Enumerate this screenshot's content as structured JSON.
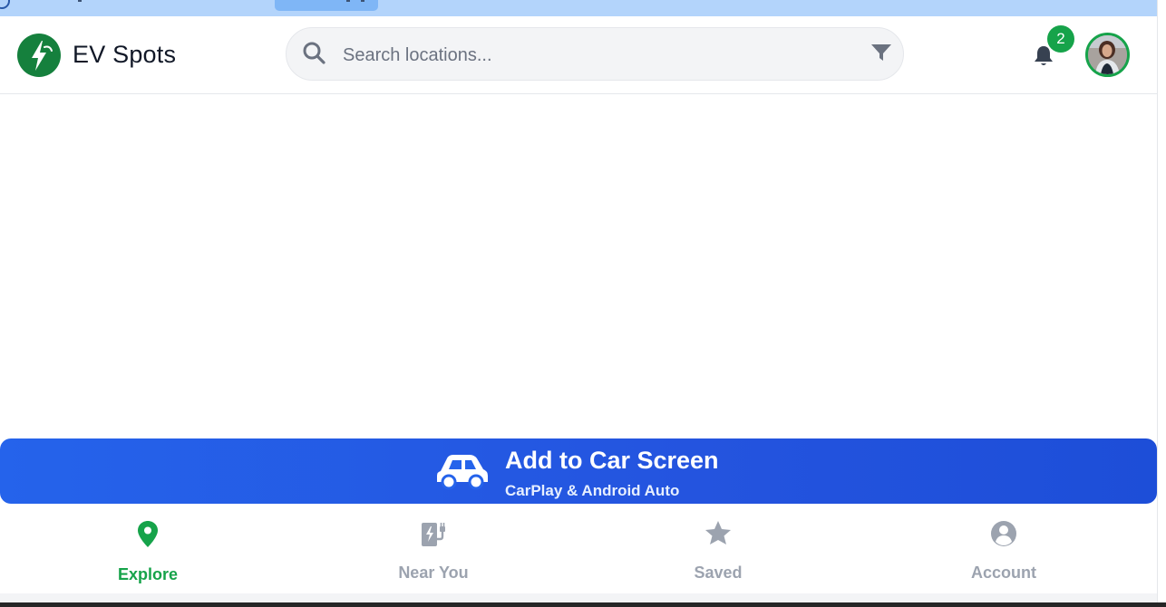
{
  "app": {
    "title": "EV Spots"
  },
  "search": {
    "placeholder": "Search locations..."
  },
  "notifications": {
    "count": "2"
  },
  "car_banner": {
    "title": "Add to Car Screen",
    "subtitle": "CarPlay & Android Auto"
  },
  "nav": {
    "items": [
      {
        "label": "Explore",
        "icon": "map-pin-icon",
        "active": true
      },
      {
        "label": "Near You",
        "icon": "charging-station-icon",
        "active": false
      },
      {
        "label": "Saved",
        "icon": "star-icon",
        "active": false
      },
      {
        "label": "Account",
        "icon": "user-circle-icon",
        "active": false
      }
    ]
  },
  "colors": {
    "brand_green": "#16a34a",
    "banner_blue": "#2563eb",
    "inactive_gray": "#9ca3af"
  }
}
